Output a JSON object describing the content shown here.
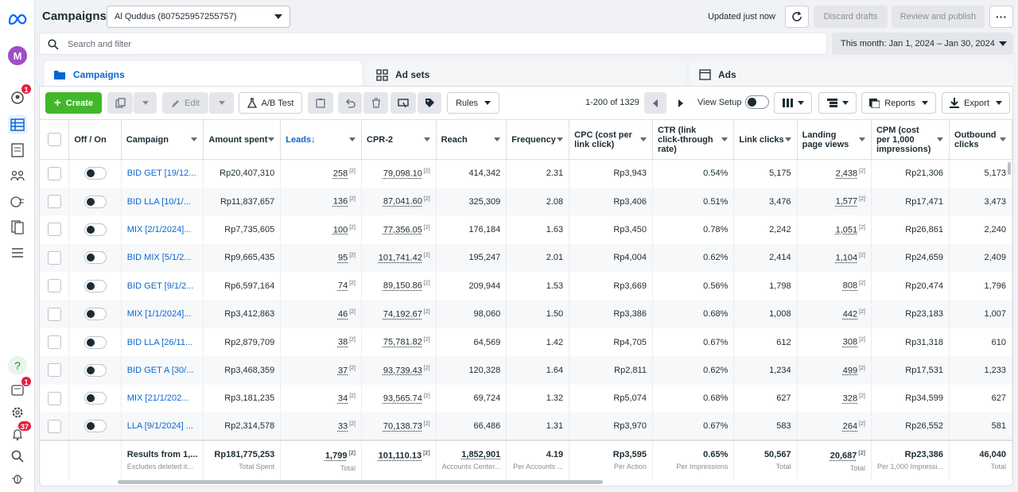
{
  "header": {
    "title": "Campaigns",
    "account": "Al Quddus (807525957255757)",
    "updated": "Updated just now",
    "discard": "Discard drafts",
    "review": "Review and publish",
    "more": "···"
  },
  "search": {
    "placeholder": "Search and filter"
  },
  "date_range": "This month: Jan 1, 2024 – Jan 30, 2024",
  "tabs": [
    {
      "label": "Campaigns"
    },
    {
      "label": "Ad sets"
    },
    {
      "label": "Ads"
    }
  ],
  "rail": {
    "avatar": "M",
    "badge_notifications": "1",
    "badge_inbox": "1",
    "badge_alerts": "37",
    "help": "?"
  },
  "toolbar": {
    "create": "Create",
    "edit": "Edit",
    "ab_test": "A/B Test",
    "rules": "Rules",
    "range": "1-200 of 1329",
    "view_setup": "View Setup",
    "reports": "Reports",
    "export": "Export"
  },
  "columns": [
    "Off / On",
    "Campaign",
    "Amount spent",
    "Leads",
    "CPR-2",
    "Reach",
    "Frequency",
    "CPC (cost per link click)",
    "CTR (link click-through rate)",
    "Link clicks",
    "Landing page views",
    "CPM (cost per 1,000 impressions)",
    "Outbound clicks"
  ],
  "sort_arrow": "↓",
  "rows": [
    {
      "campaign": "BID GET [19/12...",
      "spent": "Rp20,407,310",
      "leads": "258",
      "cpr": "79,098.10",
      "reach": "414,342",
      "freq": "2.31",
      "cpc": "Rp3,943",
      "ctr": "0.54%",
      "clicks": "5,175",
      "lpv": "2,438",
      "cpm": "Rp21,306",
      "out": "5,173"
    },
    {
      "campaign": "BID LLA [10/1/...",
      "spent": "Rp11,837,657",
      "leads": "136",
      "cpr": "87,041.60",
      "reach": "325,309",
      "freq": "2.08",
      "cpc": "Rp3,406",
      "ctr": "0.51%",
      "clicks": "3,476",
      "lpv": "1,577",
      "cpm": "Rp17,471",
      "out": "3,473"
    },
    {
      "campaign": "MIX [2/1/2024]...",
      "spent": "Rp7,735,605",
      "leads": "100",
      "cpr": "77,356.05",
      "reach": "176,184",
      "freq": "1.63",
      "cpc": "Rp3,450",
      "ctr": "0.78%",
      "clicks": "2,242",
      "lpv": "1,051",
      "cpm": "Rp26,861",
      "out": "2,240"
    },
    {
      "campaign": "BID MIX [5/1/2...",
      "spent": "Rp9,665,435",
      "leads": "95",
      "cpr": "101,741.42",
      "reach": "195,247",
      "freq": "2.01",
      "cpc": "Rp4,004",
      "ctr": "0.62%",
      "clicks": "2,414",
      "lpv": "1,104",
      "cpm": "Rp24,659",
      "out": "2,409"
    },
    {
      "campaign": "BID GET [9/1/2...",
      "spent": "Rp6,597,164",
      "leads": "74",
      "cpr": "89,150.86",
      "reach": "209,944",
      "freq": "1.53",
      "cpc": "Rp3,669",
      "ctr": "0.56%",
      "clicks": "1,798",
      "lpv": "808",
      "cpm": "Rp20,474",
      "out": "1,796"
    },
    {
      "campaign": "MIX [1/1/2024]...",
      "spent": "Rp3,412,863",
      "leads": "46",
      "cpr": "74,192.67",
      "reach": "98,060",
      "freq": "1.50",
      "cpc": "Rp3,386",
      "ctr": "0.68%",
      "clicks": "1,008",
      "lpv": "442",
      "cpm": "Rp23,183",
      "out": "1,007"
    },
    {
      "campaign": "BID LLA [26/11...",
      "spent": "Rp2,879,709",
      "leads": "38",
      "cpr": "75,781.82",
      "reach": "64,569",
      "freq": "1.42",
      "cpc": "Rp4,705",
      "ctr": "0.67%",
      "clicks": "612",
      "lpv": "308",
      "cpm": "Rp31,318",
      "out": "610"
    },
    {
      "campaign": "BID GET A [30/...",
      "spent": "Rp3,468,359",
      "leads": "37",
      "cpr": "93,739.43",
      "reach": "120,328",
      "freq": "1.64",
      "cpc": "Rp2,811",
      "ctr": "0.62%",
      "clicks": "1,234",
      "lpv": "499",
      "cpm": "Rp17,531",
      "out": "1,233"
    },
    {
      "campaign": "MIX [21/1/202...",
      "spent": "Rp3,181,235",
      "leads": "34",
      "cpr": "93,565.74",
      "reach": "69,724",
      "freq": "1.32",
      "cpc": "Rp5,074",
      "ctr": "0.68%",
      "clicks": "627",
      "lpv": "328",
      "cpm": "Rp34,599",
      "out": "627"
    },
    {
      "campaign": "LLA [9/1/2024] ...",
      "spent": "Rp2,314,578",
      "leads": "33",
      "cpr": "70,138.73",
      "reach": "66,486",
      "freq": "1.31",
      "cpc": "Rp3,970",
      "ctr": "0.67%",
      "clicks": "583",
      "lpv": "264",
      "cpm": "Rp26,552",
      "out": "581"
    }
  ],
  "sup": "[2]",
  "totals": {
    "label": "Results from 1,...",
    "label_sub": "Excludes deleted it...",
    "spent": "Rp181,775,253",
    "spent_sub": "Total Spent",
    "leads": "1,799",
    "leads_sub": "Total",
    "cpr": "101,110.13",
    "reach": "1,852,901",
    "reach_sub": "Accounts Center...",
    "freq": "4.19",
    "freq_sub": "Per Accounts ...",
    "cpc": "Rp3,595",
    "cpc_sub": "Per Action",
    "ctr": "0.65%",
    "ctr_sub": "Per Impressions",
    "clicks": "50,567",
    "clicks_sub": "Total",
    "lpv": "20,687",
    "lpv_sub": "Total",
    "cpm": "Rp23,386",
    "cpm_sub": "Per 1,000 Impressi...",
    "out": "46,040",
    "out_sub": "Total"
  }
}
